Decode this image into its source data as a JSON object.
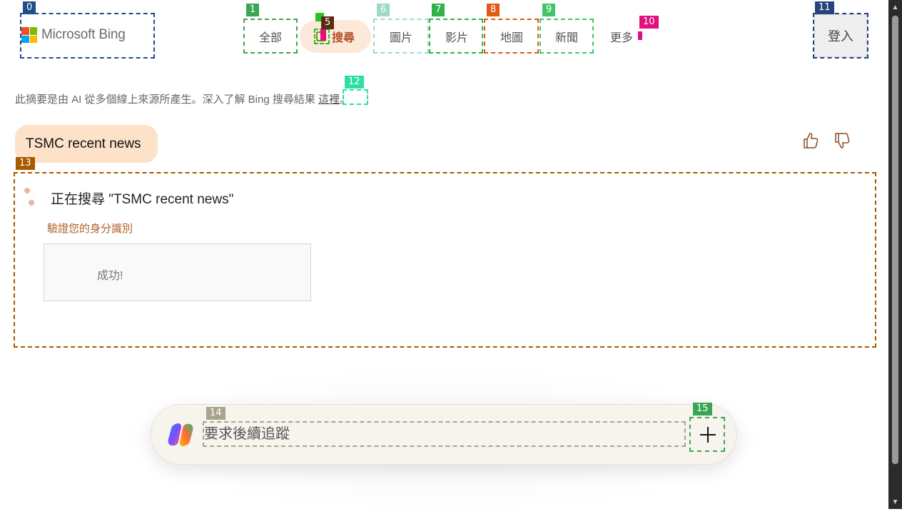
{
  "header": {
    "logo_text": "Microsoft Bing",
    "nav": [
      {
        "label": "全部"
      },
      {
        "label": "搜尋"
      },
      {
        "label": "圖片"
      },
      {
        "label": "影片"
      },
      {
        "label": "地圖"
      },
      {
        "label": "新聞"
      },
      {
        "label": "更多"
      }
    ],
    "login_label": "登入"
  },
  "disclaimer": {
    "text": "此摘要是由 AI 從多個線上來源所產生。深入了解 Bing 搜尋結果",
    "link": "這裡",
    "end": "。"
  },
  "conversation": {
    "user_query": "TSMC recent news",
    "status": "正在搜尋 \"TSMC recent news\"",
    "verify_label": "驗證您的身分識別",
    "captcha_result": "成功!"
  },
  "chat": {
    "placeholder": "要求後續追蹤"
  },
  "som_labels": [
    "0",
    "1",
    "2",
    "3",
    "4",
    "5",
    "6",
    "7",
    "8",
    "9",
    "10",
    "11",
    "12",
    "13",
    "14",
    "15"
  ],
  "colors": {
    "accent_search_bg": "#fde9d9",
    "query_bubble_bg": "#fde1c8",
    "verify_text": "#b0602a"
  }
}
